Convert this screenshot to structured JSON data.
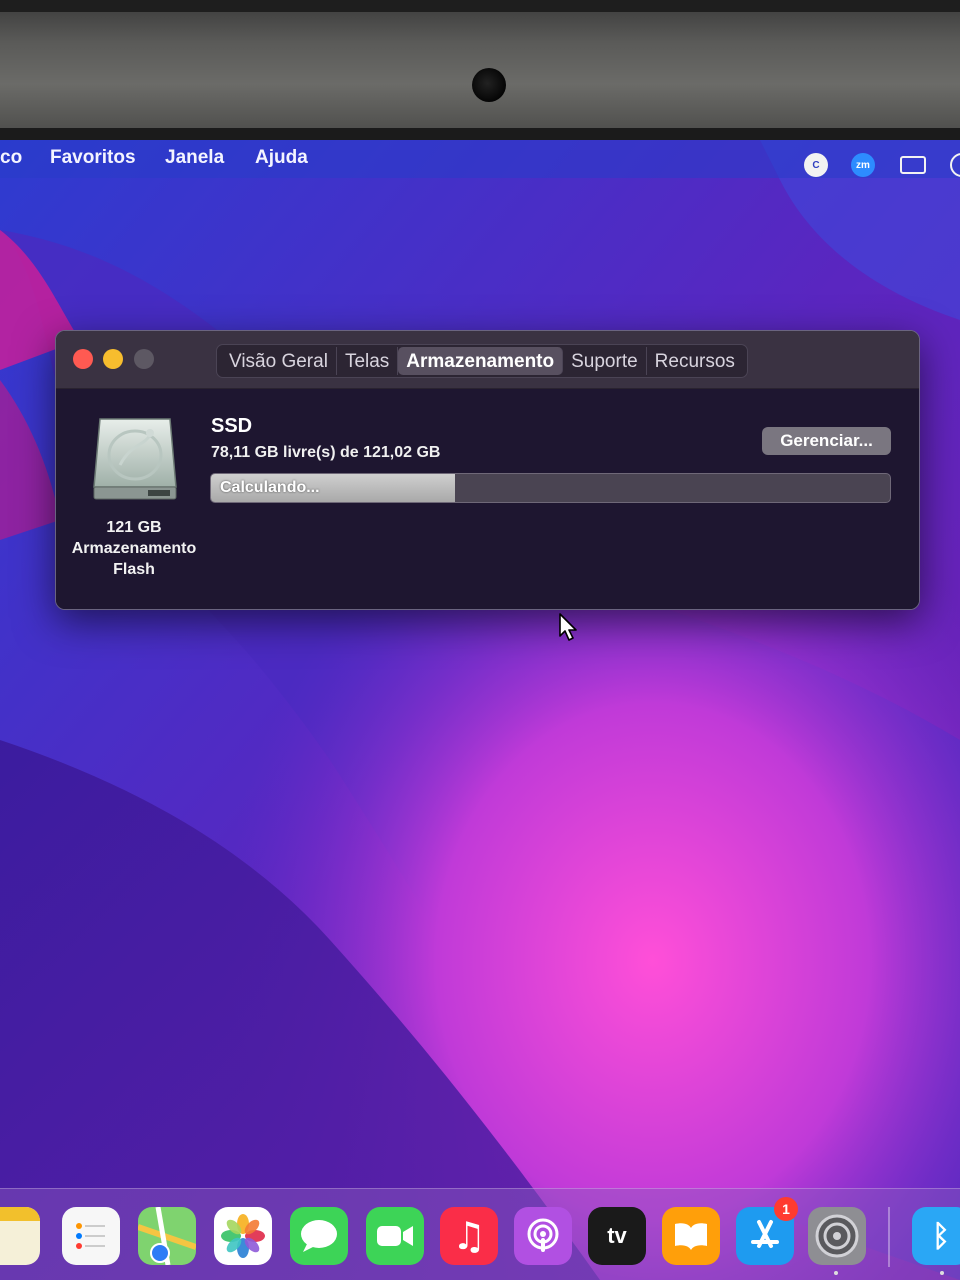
{
  "menubar": {
    "items": [
      "co",
      "Favoritos",
      "Janela",
      "Ajuda"
    ],
    "status_icons": [
      "c-icon",
      "zoom-icon",
      "screen-mirroring-icon",
      "control-center-icon"
    ],
    "zoom_label": "zm"
  },
  "window": {
    "tabs": [
      "Visão Geral",
      "Telas",
      "Armazenamento",
      "Suporte",
      "Recursos"
    ],
    "active_tab": "Armazenamento",
    "disk": {
      "size": "121 GB",
      "type_line1": "Armazenamento",
      "type_line2": "Flash"
    },
    "drive_name": "SSD",
    "free_text": "78,11 GB livre(s) de 121,02 GB",
    "manage_button": "Gerenciar...",
    "progress_label": "Calculando...",
    "progress_fraction": 0.36
  },
  "dock": {
    "apps": [
      "notes",
      "reminders",
      "maps",
      "photos",
      "messages",
      "facetime",
      "music",
      "podcasts",
      "tv",
      "books",
      "app-store",
      "system-preferences",
      "bluetooth"
    ],
    "tv_label": "tv",
    "app_store_badge": "1"
  },
  "colors": {
    "close": "#ff5a52",
    "minimize": "#f7bd2e",
    "window_bg": "#1e1630",
    "badge": "#ff3b30"
  }
}
